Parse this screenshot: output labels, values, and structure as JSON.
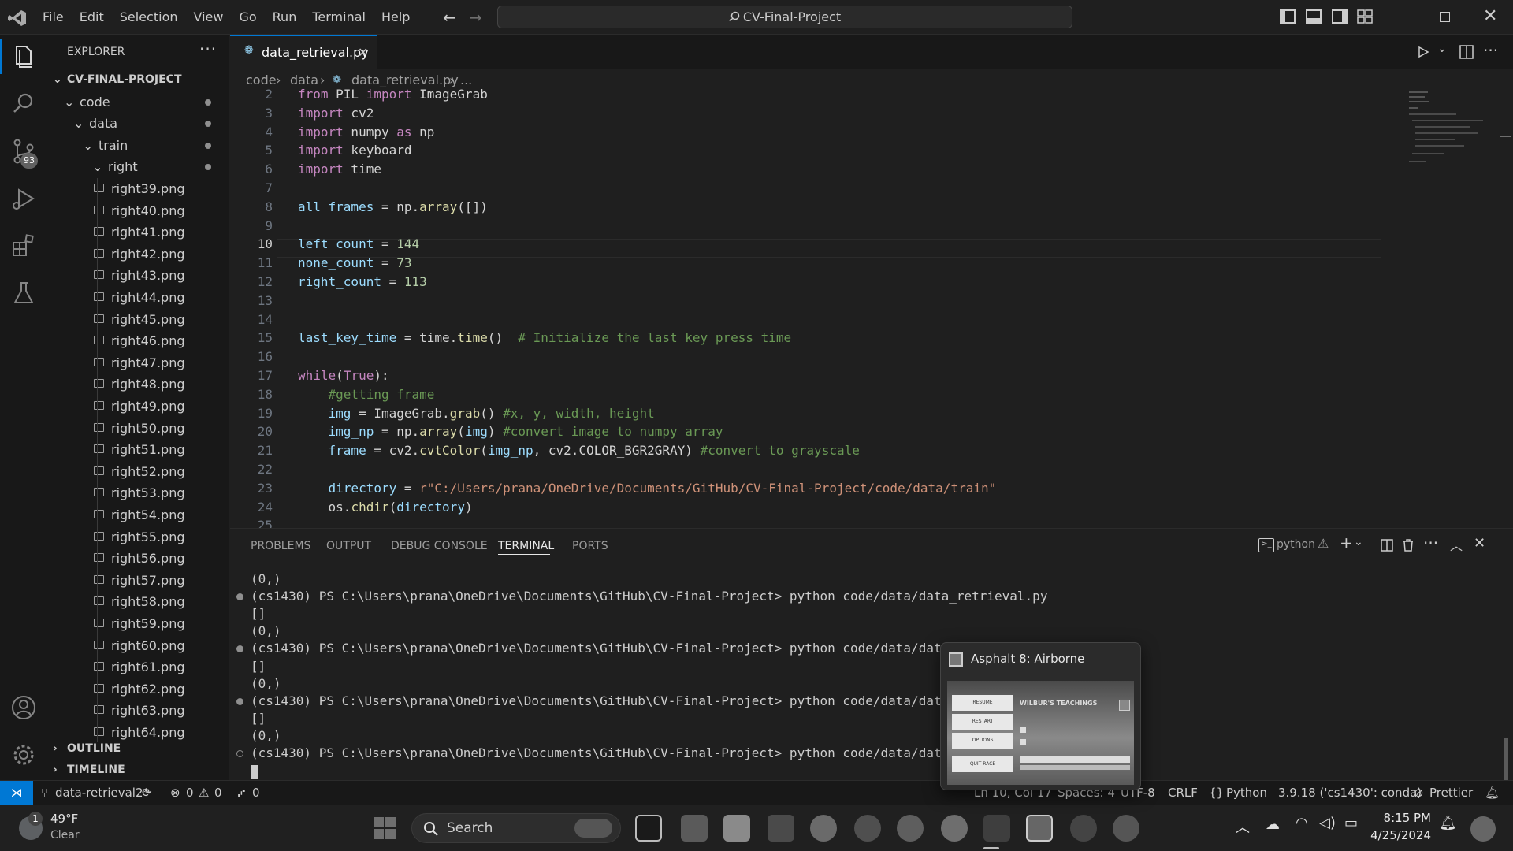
{
  "titlebar": {
    "menu": [
      "File",
      "Edit",
      "Selection",
      "View",
      "Go",
      "Run",
      "Terminal",
      "Help"
    ],
    "search_text": "CV-Final-Project"
  },
  "activity": {
    "scm_badge": "93"
  },
  "sidebar": {
    "title": "EXPLORER",
    "project": "CV-FINAL-PROJECT",
    "folders": [
      "code",
      "data",
      "train",
      "right"
    ],
    "files": [
      "right39.png",
      "right40.png",
      "right41.png",
      "right42.png",
      "right43.png",
      "right44.png",
      "right45.png",
      "right46.png",
      "right47.png",
      "right48.png",
      "right49.png",
      "right50.png",
      "right51.png",
      "right52.png",
      "right53.png",
      "right54.png",
      "right55.png",
      "right56.png",
      "right57.png",
      "right58.png",
      "right59.png",
      "right60.png",
      "right61.png",
      "right62.png",
      "right63.png",
      "right64.png"
    ],
    "outline": "OUTLINE",
    "timeline": "TIMELINE"
  },
  "editor": {
    "tab_label": "data_retrieval.py",
    "breadcrumbs": [
      "code",
      "data",
      "data_retrieval.py",
      "..."
    ],
    "lines": [
      {
        "n": "2",
        "t": "from PIL import ImageGrab"
      },
      {
        "n": "3",
        "t": "import cv2"
      },
      {
        "n": "4",
        "t": "import numpy as np"
      },
      {
        "n": "5",
        "t": "import keyboard"
      },
      {
        "n": "6",
        "t": "import time"
      },
      {
        "n": "7",
        "t": ""
      },
      {
        "n": "8",
        "t": "all_frames = np.array([])"
      },
      {
        "n": "9",
        "t": ""
      },
      {
        "n": "10",
        "t": "left_count = 144"
      },
      {
        "n": "11",
        "t": "none_count = 73"
      },
      {
        "n": "12",
        "t": "right_count = 113"
      },
      {
        "n": "13",
        "t": ""
      },
      {
        "n": "14",
        "t": ""
      },
      {
        "n": "15",
        "t": "last_key_time = time.time()  # Initialize the last key press time"
      },
      {
        "n": "16",
        "t": ""
      },
      {
        "n": "17",
        "t": "while(True):"
      },
      {
        "n": "18",
        "t": "    #getting frame"
      },
      {
        "n": "19",
        "t": "    img = ImageGrab.grab() #x, y, width, height"
      },
      {
        "n": "20",
        "t": "    img_np = np.array(img) #convert image to numpy array"
      },
      {
        "n": "21",
        "t": "    frame = cv2.cvtColor(img_np, cv2.COLOR_BGR2GRAY) #convert to grayscale"
      },
      {
        "n": "22",
        "t": ""
      },
      {
        "n": "23",
        "t": "    directory = r\"C:/Users/prana/OneDrive/Documents/GitHub/CV-Final-Project/code/data/train\""
      },
      {
        "n": "24",
        "t": "    os.chdir(directory)"
      },
      {
        "n": "25",
        "t": ""
      }
    ]
  },
  "panel": {
    "tabs": [
      "PROBLEMS",
      "OUTPUT",
      "DEBUG CONSOLE",
      "TERMINAL",
      "PORTS"
    ],
    "shell": "python",
    "terminal_lines": [
      {
        "dot": false,
        "t": "(0,)"
      },
      {
        "dot": true,
        "t": "(cs1430) PS C:\\Users\\prana\\OneDrive\\Documents\\GitHub\\CV-Final-Project> python code/data/data_retrieval.py"
      },
      {
        "dot": false,
        "t": "[]"
      },
      {
        "dot": false,
        "t": "(0,)"
      },
      {
        "dot": true,
        "t": "(cs1430) PS C:\\Users\\prana\\OneDrive\\Documents\\GitHub\\CV-Final-Project> python code/data/data_retr"
      },
      {
        "dot": false,
        "t": "[]"
      },
      {
        "dot": false,
        "t": "(0,)"
      },
      {
        "dot": true,
        "t": "(cs1430) PS C:\\Users\\prana\\OneDrive\\Documents\\GitHub\\CV-Final-Project> python code/data/data_retr"
      },
      {
        "dot": false,
        "t": "[]"
      },
      {
        "dot": false,
        "t": "(0,)"
      },
      {
        "dot": "hollow",
        "t": "(cs1430) PS C:\\Users\\prana\\OneDrive\\Documents\\GitHub\\CV-Final-Project> python code/data/data_retr"
      }
    ]
  },
  "popup": {
    "title": "Asphalt 8: Airborne",
    "thumb_heading": "WILBUR'S TEACHINGS",
    "thumb_buttons": [
      "RESUME",
      "RESTART",
      "OPTIONS",
      "QUIT RACE"
    ]
  },
  "status": {
    "branch": "data-retrieval2*",
    "errors": "0",
    "warnings": "0",
    "ports": "0",
    "position": "Ln 10, Col 17",
    "spaces": "Spaces: 4",
    "encoding": "UTF-8",
    "eol": "CRLF",
    "language": "Python",
    "interpreter": "3.9.18 ('cs1430': conda)",
    "prettier": "Prettier"
  },
  "taskbar": {
    "weather_badge": "1",
    "temp": "49°F",
    "condition": "Clear",
    "search": "Search",
    "time": "8:15 PM",
    "date": "4/25/2024"
  },
  "colors": {
    "keyword": "#c586c0",
    "variable": "#9cdcfe",
    "number": "#b5cea8",
    "comment": "#6a9955",
    "string": "#ce9178",
    "function": "#dcdcaa",
    "accent": "#0078d4"
  }
}
